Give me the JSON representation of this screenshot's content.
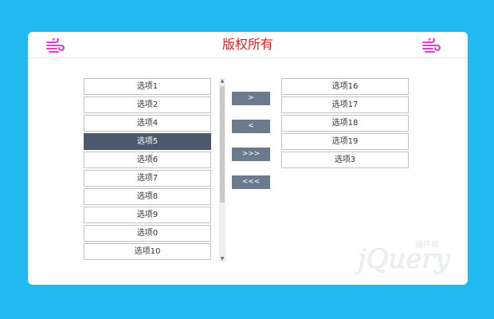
{
  "header": {
    "title": "版权所有",
    "icon": "wind-icon",
    "icon_color": "#e020d0",
    "title_color": "#e02020"
  },
  "left_list": {
    "items": [
      "选项1",
      "选项2",
      "选项4",
      "选项5",
      "选项6",
      "选项7",
      "选项8",
      "选项9",
      "选项0",
      "选项10"
    ],
    "selected": "选项5"
  },
  "right_list": {
    "items": [
      "选项16",
      "选项17",
      "选项18",
      "选项19",
      "选项3"
    ]
  },
  "buttons": {
    "move_right": ">",
    "move_left": "<",
    "move_all_right": ">>>",
    "move_all_left": "<<<"
  },
  "colors": {
    "background": "#20b9f0",
    "selected_item": "#4d5a6d",
    "button": "#6c7a8e"
  },
  "watermark": {
    "text": "jQuery",
    "subtext": "插件库"
  }
}
